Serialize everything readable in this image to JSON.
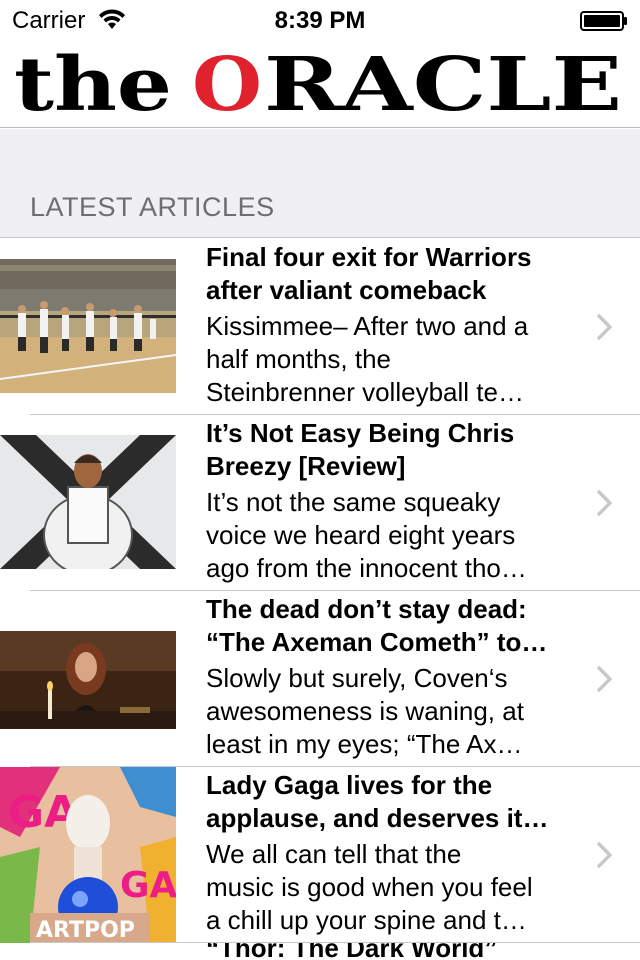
{
  "status_bar": {
    "carrier": "Carrier",
    "time": "8:39 PM"
  },
  "masthead": {
    "logo_prefix": "the",
    "logo_o": "O",
    "logo_rest": "RACLE",
    "brand_red": "#e0212e"
  },
  "section": {
    "title": "LATEST ARTICLES"
  },
  "articles": [
    {
      "title_lines": [
        "Final four exit for Warriors",
        "after valiant comeback"
      ],
      "excerpt_lines": [
        "Kissimmee– After two and a",
        "half months, the",
        "Steinbrenner volleyball te…"
      ],
      "thumb": "volleyball-gym-photo"
    },
    {
      "title_lines": [
        "It’s Not Easy Being Chris",
        "Breezy [Review]"
      ],
      "excerpt_lines": [
        "It’s not the same squeaky",
        "voice we heard eight years",
        "ago from the innocent tho…"
      ],
      "thumb": "x-album-cover"
    },
    {
      "title_lines": [
        "The dead don’t stay dead:",
        "“The Axeman Cometh” to…"
      ],
      "excerpt_lines": [
        "Slowly but surely, Coven‘s",
        "awesomeness is waning, at",
        "least in my eyes; “The Ax…"
      ],
      "thumb": "tv-still-candle"
    },
    {
      "title_lines": [
        "Lady Gaga lives for the",
        "applause, and deserves it…"
      ],
      "excerpt_lines": [
        "We all can tell that the",
        "music is good when you feel",
        "a chill up your spine and t…"
      ],
      "thumb": "artpop-album-cover"
    },
    {
      "title_lines": [
        "“Thor: The Dark World”"
      ],
      "excerpt_lines": [],
      "thumb": ""
    }
  ]
}
